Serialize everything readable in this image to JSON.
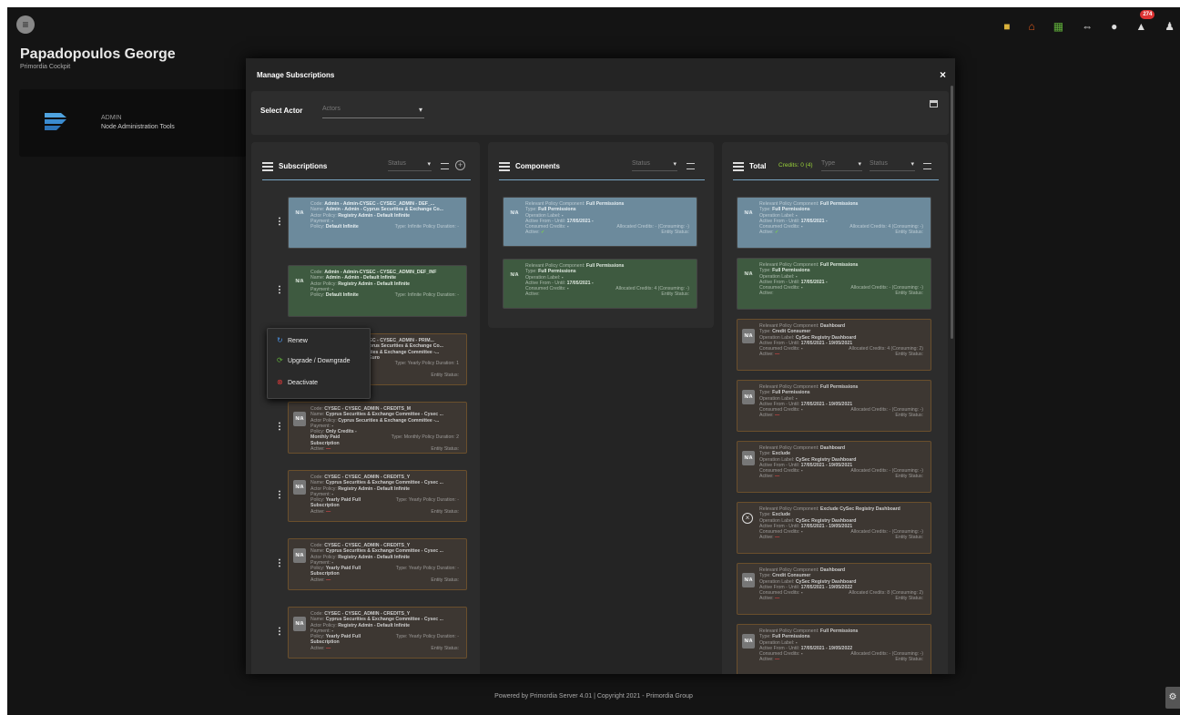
{
  "header": {
    "user_name": "Papadopoulos George",
    "subtitle": "Primordia Cockpit",
    "notification_count": "274",
    "icons": [
      "folder-icon",
      "home-icon",
      "grid-icon",
      "expand-icon",
      "account-circle-icon",
      "bell-icon",
      "user-icon"
    ]
  },
  "admin_card": {
    "title": "ADMIN",
    "subtitle": "Node Administration Tools"
  },
  "modal": {
    "title": "Manage Subscriptions",
    "close": "×",
    "select_actor_label": "Select Actor",
    "actor_placeholder": "Actors"
  },
  "subscriptions": {
    "title": "Subscriptions",
    "status_filter": "Status",
    "cards": [
      {
        "na": "N/A",
        "color": "blue",
        "lines": [
          [
            "Code:",
            "Admin - Admin-CYSEC - CYSEC_ADMIN - DEF_...",
            ""
          ],
          [
            "Name:",
            "Admin - Admin - Cyprus Securities & Exchange Co...",
            ""
          ],
          [
            "Actor Policy:",
            "Registry Admin - Default Infinite",
            ""
          ],
          [
            "Payment:",
            "-",
            ""
          ],
          [
            "Policy:",
            "Default Infinite",
            "Type: Infinite Policy   Duration: -"
          ],
          [
            "",
            "",
            "Entity Status:"
          ]
        ]
      },
      {
        "na": "N/A",
        "color": "green",
        "lines": [
          [
            "Code:",
            "Admin - Admin-CYSEC - CYSEC_ADMIN_DEF_INF",
            ""
          ],
          [
            "Name:",
            "Admin - Admin - Default Infinite",
            ""
          ],
          [
            "Actor Policy:",
            "Registry Admin - Default Infinite",
            ""
          ],
          [
            "Payment:",
            "-",
            ""
          ],
          [
            "Policy:",
            "Default Infinite",
            "Type: Infinite Policy   Duration: -"
          ],
          [
            "",
            "",
            "Entity Status:"
          ]
        ]
      },
      {
        "na": "N/A",
        "color": "brown",
        "lines": [
          [
            "Code:",
            "Admin - Admin-CYSEC - CYSEC_ADMIN - PRIM...",
            ""
          ],
          [
            "Name:",
            "Admin - Admin - Cyprus Securities & Exchange Co...",
            ""
          ],
          [
            "Actor Policy:",
            "Cyprus Securities & Exchange Committee -...",
            ""
          ],
          [
            "Payment:",
            "12/05/2021 - 100 Euro",
            ""
          ],
          [
            "Policy:",
            "Yearly Paid",
            "Type: Yearly Policy   Duration: 1"
          ],
          [
            "",
            "Subscription",
            ""
          ],
          [
            "Active:",
            "—",
            "Entity Status:"
          ]
        ]
      },
      {
        "na": "N/A",
        "color": "brown",
        "lines": [
          [
            "Code:",
            "CYSEC - CYSEC_ADMIN - CREDITS_M",
            ""
          ],
          [
            "Name:",
            "Cyprus Securities & Exchange Committee - Cysec ...",
            ""
          ],
          [
            "Actor Policy:",
            "Cyprus Securities & Exchange Committee -...",
            ""
          ],
          [
            "Payment:",
            "-",
            ""
          ],
          [
            "Policy:",
            "Only Credits -",
            ""
          ],
          [
            "",
            "Monthly Paid",
            "Type: Monthly Policy   Duration: 2"
          ],
          [
            "",
            "Subscription",
            ""
          ],
          [
            "Active:",
            "—",
            "Entity Status:"
          ]
        ]
      },
      {
        "na": "N/A",
        "color": "brown",
        "lines": [
          [
            "Code:",
            "CYSEC - CYSEC_ADMIN - CREDITS_Y",
            ""
          ],
          [
            "Name:",
            "Cyprus Securities & Exchange Committee - Cysec ...",
            ""
          ],
          [
            "Actor Policy:",
            "Registry Admin - Default Infinite",
            ""
          ],
          [
            "Payment:",
            "-",
            ""
          ],
          [
            "Policy:",
            "Yearly Paid Full",
            "Type: Yearly Policy   Duration: -"
          ],
          [
            "",
            "Subscription",
            ""
          ],
          [
            "Active:",
            "—",
            "Entity Status:"
          ]
        ]
      },
      {
        "na": "N/A",
        "color": "brown",
        "lines": [
          [
            "Code:",
            "CYSEC - CYSEC_ADMIN - CREDITS_Y",
            ""
          ],
          [
            "Name:",
            "Cyprus Securities & Exchange Committee - Cysec ...",
            ""
          ],
          [
            "Actor Policy:",
            "Registry Admin - Default Infinite",
            ""
          ],
          [
            "Payment:",
            "-",
            ""
          ],
          [
            "Policy:",
            "Yearly Paid Full",
            "Type: Yearly Policy   Duration: -"
          ],
          [
            "",
            "Subscription",
            ""
          ],
          [
            "Active:",
            "—",
            "Entity Status:"
          ]
        ]
      },
      {
        "na": "N/A",
        "color": "brown",
        "lines": [
          [
            "Code:",
            "CYSEC - CYSEC_ADMIN - CREDITS_Y",
            ""
          ],
          [
            "Name:",
            "Cyprus Securities & Exchange Committee - Cysec ...",
            ""
          ],
          [
            "Actor Policy:",
            "Registry Admin - Default Infinite",
            ""
          ],
          [
            "Payment:",
            "-",
            ""
          ],
          [
            "Policy:",
            "Yearly Paid Full",
            "Type: Yearly Policy   Duration: -"
          ],
          [
            "",
            "Subscription",
            ""
          ],
          [
            "Active:",
            "—",
            "Entity Status:"
          ]
        ]
      }
    ]
  },
  "context_menu": {
    "items": [
      "Renew",
      "Upgrade / Downgrade",
      "Deactivate"
    ]
  },
  "components": {
    "title": "Components",
    "status_filter": "Status",
    "cards": [
      {
        "na": "N/A",
        "color": "blue",
        "lines": [
          [
            "Relevant Policy Component:",
            "Full Permissions",
            ""
          ],
          [
            "Type:",
            "Full Permissions",
            ""
          ],
          [
            "Operation Label:",
            "-",
            ""
          ],
          [
            "Active From - Until:",
            "17/05/2021 -",
            ""
          ],
          [
            "Consumed Credits:",
            "-",
            "Allocated Credits: - (Consuming: -)"
          ],
          [
            "Active:",
            "✓",
            "Entity Status:"
          ]
        ]
      },
      {
        "na": "N/A",
        "color": "green",
        "lines": [
          [
            "Relevant Policy Component:",
            "Full Permissions",
            ""
          ],
          [
            "Type:",
            "Full Permissions",
            ""
          ],
          [
            "Operation Label:",
            "-",
            ""
          ],
          [
            "Active From - Until:",
            "17/05/2021 -",
            ""
          ],
          [
            "Consumed Credits:",
            "-",
            "Allocated Credits: 4 (Consuming: -)"
          ],
          [
            "Active:",
            "",
            "Entity Status:"
          ]
        ]
      }
    ]
  },
  "total": {
    "title": "Total",
    "credits": "Credits: 0 (4)",
    "type_filter": "Type",
    "status_filter": "Status",
    "cards": [
      {
        "na": "N/A",
        "color": "blue",
        "lines": [
          [
            "Relevant Policy Component:",
            "Full Permissions",
            ""
          ],
          [
            "Type:",
            "Full Permissions",
            ""
          ],
          [
            "Operation Label:",
            "-",
            ""
          ],
          [
            "Active From - Until:",
            "17/05/2021 -",
            ""
          ],
          [
            "Consumed Credits:",
            "-",
            "Allocated Credits: 4 (Consuming: -)"
          ],
          [
            "Active:",
            "✓",
            "Entity Status:"
          ]
        ]
      },
      {
        "na": "N/A",
        "color": "green",
        "lines": [
          [
            "Relevant Policy Component:",
            "Full Permissions",
            ""
          ],
          [
            "Type:",
            "Full Permissions",
            ""
          ],
          [
            "Operation Label:",
            "-",
            ""
          ],
          [
            "Active From - Until:",
            "17/05/2021 -",
            ""
          ],
          [
            "Consumed Credits:",
            "-",
            "Allocated Credits: - (Consuming: -)"
          ],
          [
            "Active:",
            "",
            "Entity Status:"
          ]
        ]
      },
      {
        "na": "N/A",
        "color": "brown",
        "lines": [
          [
            "Relevant Policy Component:",
            "Dashboard",
            ""
          ],
          [
            "Type:",
            "Credit Consumer",
            ""
          ],
          [
            "Operation Label:",
            "CySec Registry Dashboard",
            ""
          ],
          [
            "Active From - Until:",
            "17/05/2021 - 19/05/2021",
            ""
          ],
          [
            "Consumed Credits:",
            "-",
            "Allocated Credits: 4 (Consuming: 2)"
          ],
          [
            "Active:",
            "—",
            "Entity Status:"
          ]
        ]
      },
      {
        "na": "N/A",
        "color": "brown",
        "lines": [
          [
            "Relevant Policy Component:",
            "Full Permissions",
            ""
          ],
          [
            "Type:",
            "Full Permissions",
            ""
          ],
          [
            "Operation Label:",
            "-",
            ""
          ],
          [
            "Active From - Until:",
            "17/05/2021 - 19/05/2021",
            ""
          ],
          [
            "Consumed Credits:",
            "-",
            "Allocated Credits: - (Consuming: -)"
          ],
          [
            "Active:",
            "—",
            "Entity Status:"
          ]
        ]
      },
      {
        "na": "N/A",
        "color": "brown",
        "lines": [
          [
            "Relevant Policy Component:",
            "Dashboard",
            ""
          ],
          [
            "Type:",
            "Exclude",
            ""
          ],
          [
            "Operation Label:",
            "CySec Registry Dashboard",
            ""
          ],
          [
            "Active From - Until:",
            "17/05/2021 - 19/05/2021",
            ""
          ],
          [
            "Consumed Credits:",
            "-",
            "Allocated Credits: - (Consuming: -)"
          ],
          [
            "Active:",
            "—",
            "Entity Status:"
          ]
        ]
      },
      {
        "na": "",
        "color": "brown",
        "lines": [
          [
            "Relevant Policy Component:",
            "Exclude CySec Registry Dashboard",
            ""
          ],
          [
            "Type:",
            "Exclude",
            ""
          ],
          [
            "Operation Label:",
            "CySec Registry Dashboard",
            ""
          ],
          [
            "Active From - Until:",
            "17/05/2021 - 19/05/2021",
            ""
          ],
          [
            "Consumed Credits:",
            "-",
            "Allocated Credits: - (Consuming: -)"
          ],
          [
            "Active:",
            "—",
            "Entity Status:"
          ]
        ]
      },
      {
        "na": "N/A",
        "color": "brown",
        "lines": [
          [
            "Relevant Policy Component:",
            "Dashboard",
            ""
          ],
          [
            "Type:",
            "Credit Consumer",
            ""
          ],
          [
            "Operation Label:",
            "CySec Registry Dashboard",
            ""
          ],
          [
            "Active From - Until:",
            "17/05/2021 - 19/05/2022",
            ""
          ],
          [
            "Consumed Credits:",
            "-",
            "Allocated Credits: 8 (Consuming: 2)"
          ],
          [
            "Active:",
            "—",
            "Entity Status:"
          ]
        ]
      },
      {
        "na": "N/A",
        "color": "brown",
        "lines": [
          [
            "Relevant Policy Component:",
            "Full Permissions",
            ""
          ],
          [
            "Type:",
            "Full Permissions",
            ""
          ],
          [
            "Operation Label:",
            "-",
            ""
          ],
          [
            "Active From - Until:",
            "17/05/2021 - 19/05/2022",
            ""
          ],
          [
            "Consumed Credits:",
            "-",
            "Allocated Credits: - (Consuming: -)"
          ],
          [
            "Active:",
            "—",
            "Entity Status:"
          ]
        ]
      }
    ]
  },
  "footer": "Powered by Primordia Server 4.01 | Copyright 2021 - Primordia Group"
}
